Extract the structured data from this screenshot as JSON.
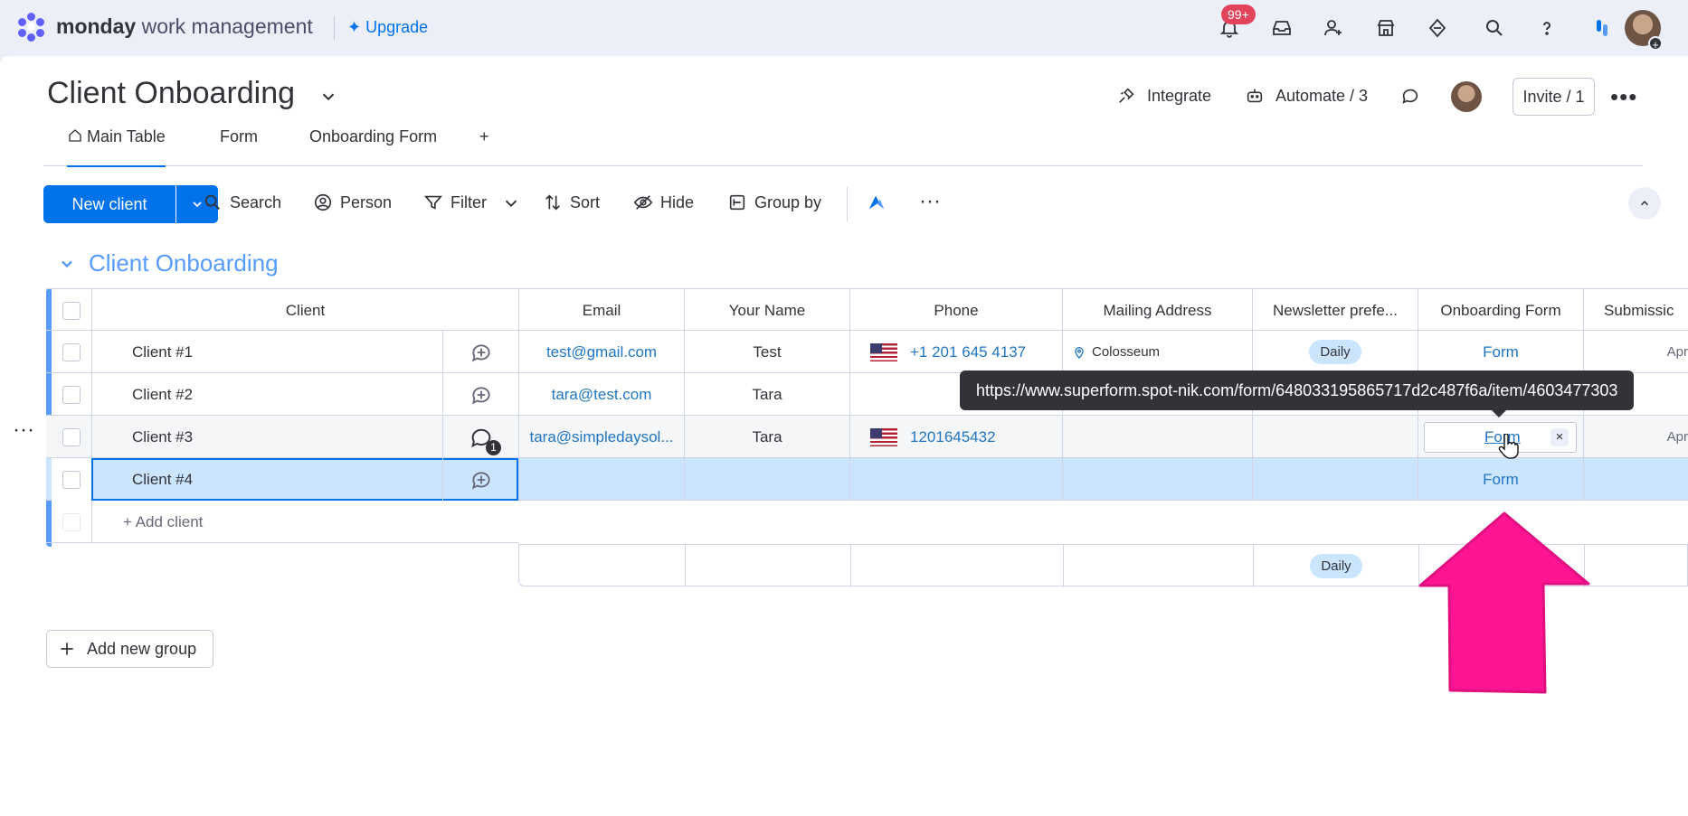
{
  "topbar": {
    "brand_bold": "monday",
    "brand_rest": " work management",
    "upgrade": "✦ Upgrade",
    "notifications_badge": "99+",
    "icons": [
      "bell-icon",
      "inbox-icon",
      "invite-members-icon",
      "apps-marketplace-icon",
      "gem-icon",
      "search-icon",
      "help-icon",
      "app-switcher-icon"
    ]
  },
  "header": {
    "title": "Client Onboarding",
    "integrate": "Integrate",
    "automate": "Automate / 3",
    "invite": "Invite / 1"
  },
  "tabs": [
    {
      "label": "Main Table",
      "active": true
    },
    {
      "label": "Form"
    },
    {
      "label": "Onboarding Form"
    },
    {
      "label": "+"
    }
  ],
  "toolbar": {
    "new_item": "New client",
    "search": "Search",
    "person": "Person",
    "filter": "Filter",
    "sort": "Sort",
    "hide": "Hide",
    "group_by": "Group by"
  },
  "group": {
    "title": "Client Onboarding",
    "color": "#579bfc",
    "columns": [
      "Client",
      "Email",
      "Your Name",
      "Phone",
      "Mailing Address",
      "Newsletter prefe...",
      "Onboarding Form",
      "Submissic"
    ],
    "rows": [
      {
        "client": "Client #1",
        "updates": "",
        "email": "test@gmail.com",
        "name": "Test",
        "phone": "+1 201 645 4137",
        "address": "Colosseum",
        "newsletter": "Daily",
        "form": "Form",
        "submission": "Apr"
      },
      {
        "client": "Client #2",
        "updates": "",
        "email": "tara@test.com",
        "name": "Tara",
        "phone": "",
        "address": "",
        "newsletter": "",
        "form": "",
        "submission": ""
      },
      {
        "client": "Client #3",
        "updates": "1",
        "email": "tara@simpledaysol...",
        "name": "Tara",
        "phone": "1201645432",
        "address": "",
        "newsletter": "",
        "form": "Form",
        "submission": "Apr"
      },
      {
        "client": "Client #4",
        "updates": "",
        "email": "",
        "name": "",
        "phone": "",
        "address": "",
        "newsletter": "",
        "form": "Form",
        "submission": ""
      }
    ],
    "add_item": "+ Add client",
    "summary_newsletter": "Daily"
  },
  "tooltip": "https://www.superform.spot-nik.com/form/648033195865717d2c487f6a/item/4603477303",
  "add_group": "Add new group",
  "colors": {
    "accent": "#0073ea",
    "arrow": "#ff1493",
    "pill": "#cce5ff"
  }
}
